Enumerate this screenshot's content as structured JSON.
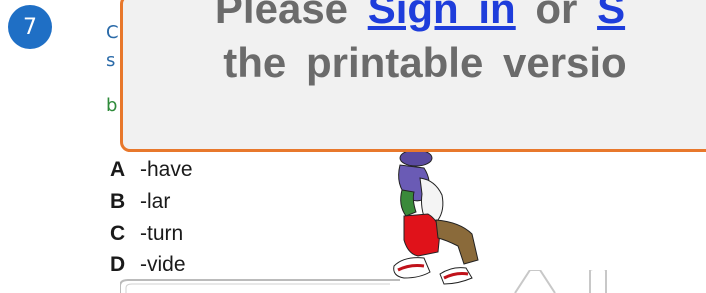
{
  "question": {
    "number": "7",
    "text_fragments": [
      "C",
      "s",
      "b"
    ]
  },
  "options": [
    {
      "letter": "A",
      "text": "-have"
    },
    {
      "letter": "B",
      "text": "-lar"
    },
    {
      "letter": "C",
      "text": "-turn"
    },
    {
      "letter": "D",
      "text": "-vide"
    }
  ],
  "overlay": {
    "line1_prefix": "Please",
    "signin_link": "Sign in",
    "line1_middle": "or",
    "signup_link_partial": "S",
    "line2": "the printable versio"
  },
  "colors": {
    "badge": "#1f6fc5",
    "overlay_border": "#e8782c",
    "link": "#1e3ddb"
  }
}
